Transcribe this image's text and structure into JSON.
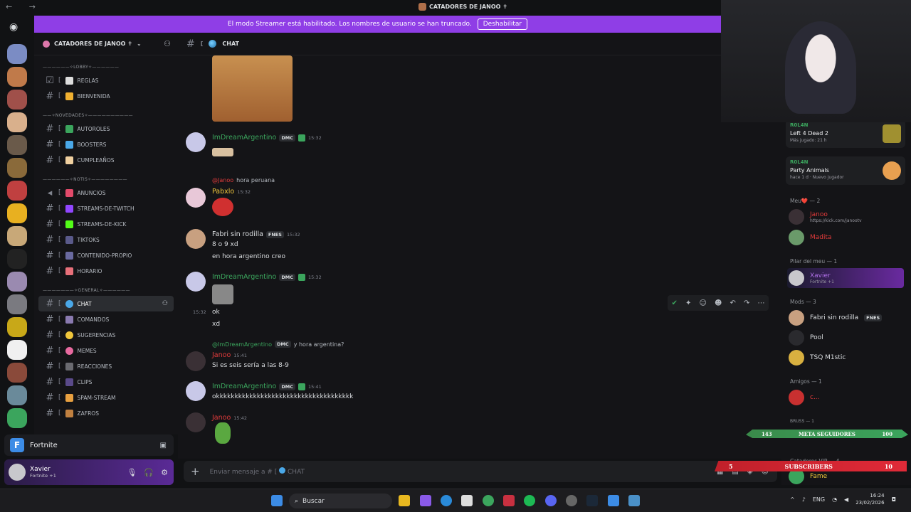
{
  "window": {
    "title": "CATADORES DE JANOO ✝"
  },
  "banner": {
    "text": "El modo Streamer está habilitado. Los nombres de usuario se han truncado.",
    "button": "Deshabilitar"
  },
  "server": {
    "name": "CATADORES DE JANOO ✝"
  },
  "categories": {
    "lobby": "——————✧LOBBY✧——————",
    "novedades": "——✧NOVEDADES✧——————————",
    "notis": "——————✧NOTIS✧————————",
    "general": "———————✧GENERAL✧——————"
  },
  "channels": [
    "REGLAS",
    "BIENVENIDA",
    "AUTOROLES",
    "BOOSTERS",
    "CUMPLEAÑOS",
    "ANUNCIOS",
    "STREAMS-DE-TWITCH",
    "STREAMS-DE-KICK",
    "TIKTOKS",
    "CONTENIDO-PROPIO",
    "HORARIO",
    "CHAT",
    "COMANDOS",
    "SUGERENCIAS",
    "MEMES",
    "REACCIONES",
    "CLIPS",
    "SPAM-STREAM",
    "ZAFROS"
  ],
  "activity_game": {
    "name": "Fortnite"
  },
  "user": {
    "name": "Xavier",
    "status": "Fortnite +1"
  },
  "chat": {
    "channel": "CHAT",
    "input_placeholder": "Enviar mensaje a #",
    "input_channel": "CHAT"
  },
  "messages": [
    {
      "author": "ImDreamArgentino",
      "tag": "DMC",
      "time": "15:32"
    },
    {
      "reply_to": "@Janoo",
      "reply_text": "hora peruana",
      "author": "Pabxlo",
      "time": "15:32"
    },
    {
      "author": "Fabri sin rodilla",
      "tag": "FNES",
      "time": "15:32",
      "lines": [
        "8 o 9 xd",
        "en hora argentino creo"
      ]
    },
    {
      "author": "ImDreamArgentino",
      "tag": "DMC",
      "time": "15:32",
      "extra_time": "15:32",
      "lines": [
        "ok",
        "xd"
      ]
    },
    {
      "reply_to": "@ImDreamArgentino",
      "reply_tag": "DMC",
      "reply_text": "y hora argentina?",
      "author": "Janoo",
      "time": "15:41",
      "lines": [
        "Si es seis sería a las 8-9"
      ]
    },
    {
      "author": "ImDreamArgentino",
      "tag": "DMC",
      "time": "15:41",
      "lines": [
        "okkkkkkkkkkkkkkkkkkkkkkkkkkkkkkkkkkkkk"
      ]
    },
    {
      "author": "Janoo",
      "time": "15:42"
    }
  ],
  "members": {
    "activities": [
      {
        "user": "R0L4N",
        "game": "Left 4 Dead 2",
        "detail": "Más jugado: 21 h"
      },
      {
        "user": "R0L4N",
        "game": "Party Animals",
        "detail": "hace 1 d  ·  Nuevo jugador"
      }
    ],
    "groups": [
      {
        "label": "Meu❤️ — 2",
        "members": [
          {
            "name": "Janoo",
            "sub": "https://kick.com/janootv"
          },
          {
            "name": "Madita"
          }
        ]
      },
      {
        "label": "Pilar del meu — 1",
        "members": [
          {
            "name": "Xavier",
            "sub": "Fortnite +1"
          }
        ]
      },
      {
        "label": "Mods — 3",
        "members": [
          {
            "name": "Fabri sin rodilla",
            "tag": "FNES"
          },
          {
            "name": "Pool"
          },
          {
            "name": "TSQ M1stic"
          }
        ]
      },
      {
        "label": "Amigos — 1",
        "members": [
          {
            "name": "c..."
          }
        ]
      },
      {
        "label": "BRUSS — 1",
        "members": []
      },
      {
        "label": "Catadores VIP — 4",
        "members": [
          {
            "name": "Fame"
          }
        ]
      }
    ]
  },
  "overlay": {
    "meta_left": "143",
    "meta_label": "META SEGUIDORES",
    "meta_right": "100",
    "sub_left": "5",
    "sub_label": "SUBSCRIBERS",
    "sub_right": "10"
  },
  "taskbar": {
    "search": "Buscar",
    "lang": "ENG",
    "time": "16:24",
    "date": "23/02/2026"
  },
  "colors": {
    "accent": "#8f3ee6",
    "green_name": "#3ba55d",
    "red_name": "#e23b3b",
    "yellow_name": "#f0c63b"
  }
}
